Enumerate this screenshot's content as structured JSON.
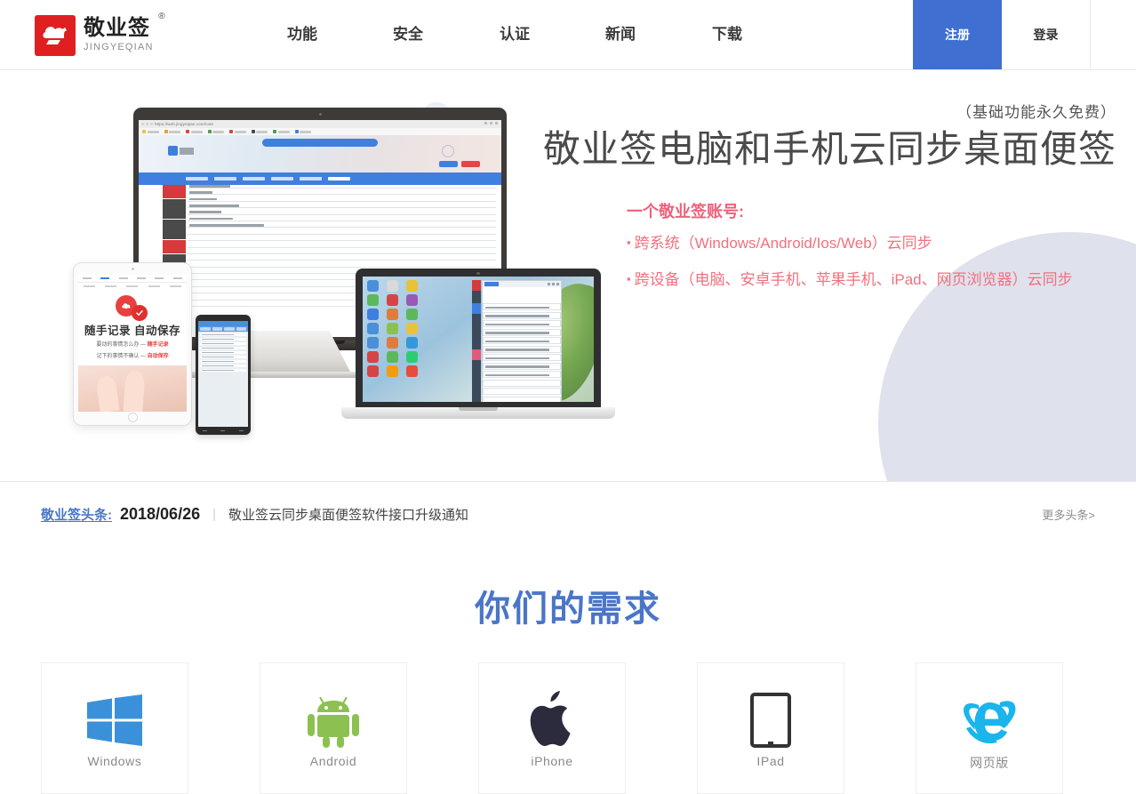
{
  "brand": {
    "name_cn": "敬业签",
    "name_en": "JINGYEQIAN",
    "registered_mark": "®",
    "logo_color": "#e02020"
  },
  "nav": {
    "items": [
      {
        "label": "功能",
        "name": "nav-features"
      },
      {
        "label": "安全",
        "name": "nav-security"
      },
      {
        "label": "认证",
        "name": "nav-certification"
      },
      {
        "label": "新闻",
        "name": "nav-news"
      },
      {
        "label": "下载",
        "name": "nav-download"
      }
    ],
    "register_label": "注册",
    "login_label": "登录",
    "register_bg": "#3f6fd0"
  },
  "hero": {
    "free_note": "（基础功能永久免费）",
    "title": "敬业签电脑和手机云同步桌面便签",
    "subtitle": "一个敬业签账号:",
    "bullets": [
      "跨系统（Windows/Android/Ios/Web）云同步",
      "跨设备（电脑、安卓手机、苹果手机、iPad、网页浏览器）云同步"
    ],
    "accent_color": "#f0607a",
    "device_browser_url": "https://web.jingyeqian.com/note",
    "tablet_heading": "随手记录 自动保存",
    "tablet_line1_pre": "要动的事情怎么办 — ",
    "tablet_line1_em": "随手记录",
    "tablet_line2_pre": "记下的事情不确认 — ",
    "tablet_line2_em": "自动保存"
  },
  "news": {
    "label": "敬业签头条:",
    "date": "2018/06/26",
    "divider": "｜",
    "title": "敬业签云同步桌面便签软件接口升级通知",
    "more": "更多头条>",
    "label_color": "#4a76c8"
  },
  "needs": {
    "title": "你们的需求",
    "title_color": "#4a76c8",
    "platforms": [
      {
        "label": "Windows",
        "icon": "windows-icon",
        "color": "#3b91d9"
      },
      {
        "label": "Android",
        "icon": "android-icon",
        "color": "#8cc152"
      },
      {
        "label": "iPhone",
        "icon": "apple-icon",
        "color": "#2b2b3d"
      },
      {
        "label": "IPad",
        "icon": "ipad-icon",
        "color": "#333333"
      },
      {
        "label": "网页版",
        "icon": "internet-explorer-icon",
        "color": "#19b5ec"
      }
    ]
  }
}
